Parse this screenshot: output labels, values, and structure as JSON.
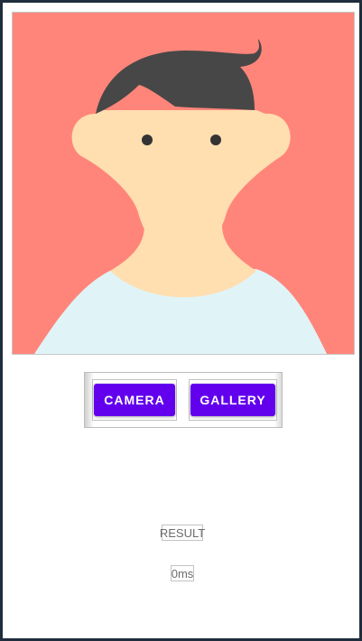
{
  "image_view": {
    "content": "avatar-illustration",
    "colors": {
      "background": "#ff857a",
      "skin": "#ffdeb0",
      "hair": "#474747",
      "eyes": "#333333",
      "shirt": "#e0f4f8"
    }
  },
  "buttons": {
    "camera_label": "CAMERA",
    "gallery_label": "GALLERY",
    "color": "#6200ee",
    "text_color": "#ffffff"
  },
  "result": {
    "label": "RESULT",
    "time": "0ms"
  }
}
